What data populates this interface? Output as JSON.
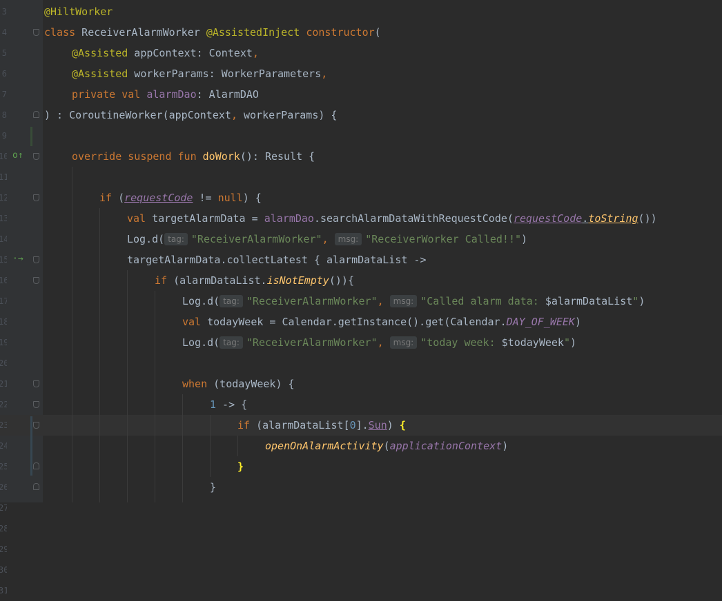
{
  "line_numbers": [
    "3",
    "4",
    "5",
    "6",
    "7",
    "8",
    "9",
    "10",
    "11",
    "12",
    "13",
    "14",
    "15",
    "16",
    "17",
    "18",
    "19",
    "20",
    "21",
    "22",
    "23",
    "24",
    "25",
    "26",
    "27",
    "28",
    "29",
    "30",
    "31"
  ],
  "gutter_icons": {
    "override_marker": "o↑",
    "suspend_call_marker": "·→"
  },
  "inlay_hints": {
    "tag": "tag:",
    "msg": "msg:"
  },
  "code": {
    "l1": {
      "annotation": "@HiltWorker"
    },
    "l2": {
      "kw_class": "class",
      "class_name": " ReceiverAlarmWorker ",
      "annotation": "@AssistedInject",
      "space": " ",
      "kw_constructor": "constructor",
      "paren": "("
    },
    "l3": {
      "annotation": "@Assisted",
      "param": " appContext: Context",
      "comma": ","
    },
    "l4": {
      "annotation": "@Assisted",
      "param": " workerParams: WorkerParameters",
      "comma": ","
    },
    "l5": {
      "kw": "private val",
      "space": " ",
      "prop": "alarmDao",
      "rest": ": AlarmDAO"
    },
    "l6": {
      "a": ") : CoroutineWorker(appContext",
      "comma": ",",
      "b": " workerParams) {"
    },
    "l8": {
      "kw": "override suspend fun",
      "space": " ",
      "fn": "doWork",
      "rest": "(): Result {"
    },
    "l10": {
      "kw": "if",
      "a": " (",
      "var": "requestCode",
      "b": " != ",
      "kw_null": "null",
      "c": ") {"
    },
    "l11": {
      "kw": "val",
      "a": " targetAlarmData = ",
      "prop": "alarmDao",
      "b": ".searchAlarmDataWithRequestCode(",
      "var": "requestCode",
      "dot": ".",
      "ext": "toString",
      "c": "())"
    },
    "l12": {
      "a": "Log.d(",
      "tag_val": "\"ReceiverAlarmWorker\"",
      "comma": ",",
      "sp": " ",
      "msg_val": "\"ReceiverWorker Called!!\"",
      "b": ")"
    },
    "l13": {
      "a": "targetAlarmData.collectLatest { alarmDataList ->"
    },
    "l14": {
      "kw": "if",
      "a": " (alarmDataList.",
      "ext": "isNotEmpty",
      "b": "()){"
    },
    "l15": {
      "a": "Log.d(",
      "tag_val": "\"ReceiverAlarmWorker\"",
      "comma": ",",
      "sp": " ",
      "msg_val1": "\"Called alarm data: ",
      "tmpl": "$alarmDataList",
      "msg_val2": "\"",
      "b": ")"
    },
    "l16": {
      "kw": "val",
      "a": " todayWeek = Calendar.getInstance().get(Calendar.",
      "const": "DAY_OF_WEEK",
      "b": ")"
    },
    "l17": {
      "a": "Log.d(",
      "tag_val": "\"ReceiverAlarmWorker\"",
      "comma": ",",
      "sp": " ",
      "msg_val1": "\"today week: ",
      "tmpl": "$todayWeek",
      "msg_val2": "\"",
      "b": ")"
    },
    "l19": {
      "kw": "when",
      "a": " (todayWeek) {"
    },
    "l20": {
      "num": "1",
      "a": " -> {"
    },
    "l21": {
      "kw": "if",
      "a": " (alarmDataList[",
      "num": "0",
      "b": "].",
      "prop": "Sun",
      "c": ") ",
      "brace": "{"
    },
    "l22": {
      "fn": "openOnAlarmActivity",
      "a": "(",
      "prop": "applicationContext",
      "b": ")"
    },
    "l23": {
      "brace": "}"
    },
    "l24": {
      "a": "}"
    }
  },
  "colors": {
    "background": "#2b2b2b",
    "keyword": "#cc7832",
    "annotation": "#bbb529",
    "string": "#6a8759",
    "number": "#6897bb",
    "function": "#ffc66d",
    "property": "#9876aa",
    "default": "#a9b7c6"
  }
}
